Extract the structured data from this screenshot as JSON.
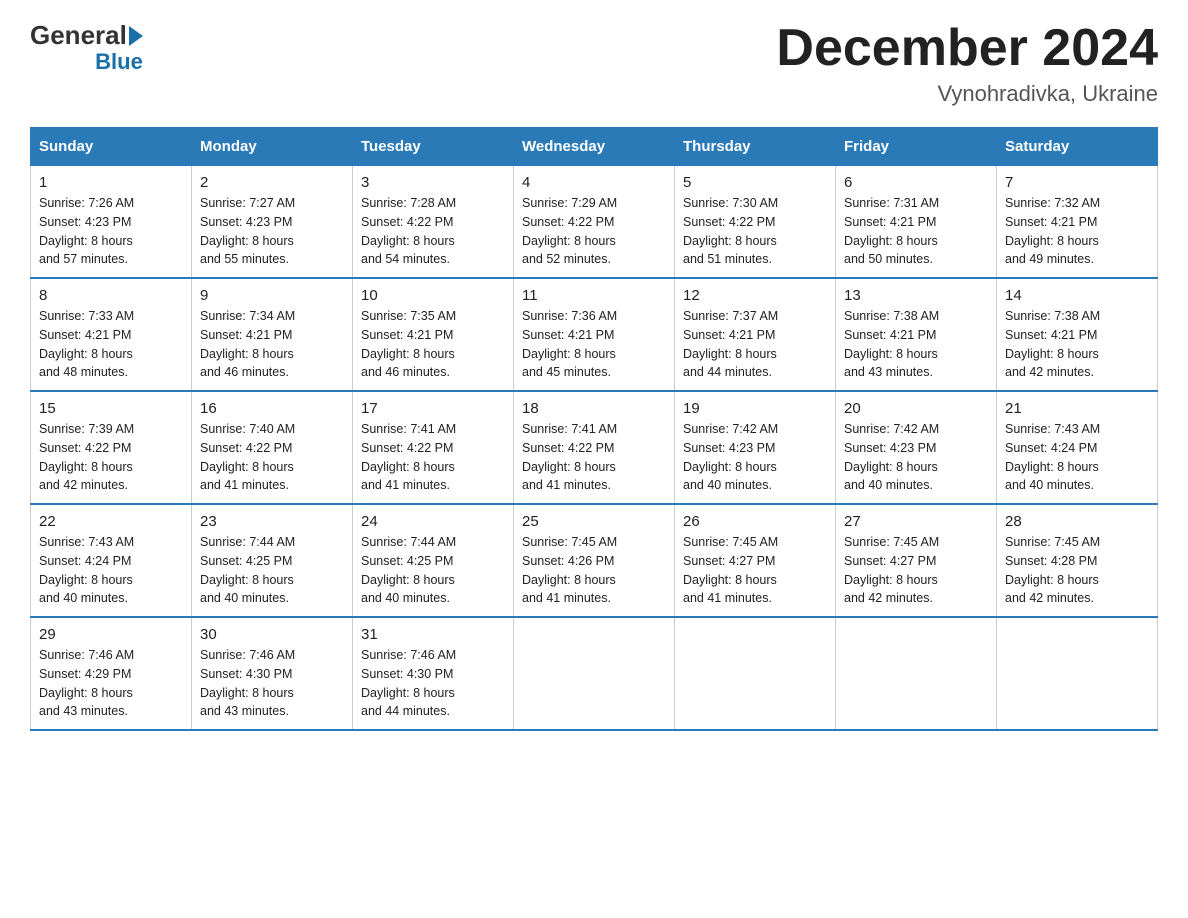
{
  "header": {
    "logo_general": "General",
    "logo_blue": "Blue",
    "month_title": "December 2024",
    "location": "Vynohradivka, Ukraine"
  },
  "days_of_week": [
    "Sunday",
    "Monday",
    "Tuesday",
    "Wednesday",
    "Thursday",
    "Friday",
    "Saturday"
  ],
  "weeks": [
    [
      {
        "day": "1",
        "sunrise": "7:26 AM",
        "sunset": "4:23 PM",
        "daylight": "8 hours and 57 minutes."
      },
      {
        "day": "2",
        "sunrise": "7:27 AM",
        "sunset": "4:23 PM",
        "daylight": "8 hours and 55 minutes."
      },
      {
        "day": "3",
        "sunrise": "7:28 AM",
        "sunset": "4:22 PM",
        "daylight": "8 hours and 54 minutes."
      },
      {
        "day": "4",
        "sunrise": "7:29 AM",
        "sunset": "4:22 PM",
        "daylight": "8 hours and 52 minutes."
      },
      {
        "day": "5",
        "sunrise": "7:30 AM",
        "sunset": "4:22 PM",
        "daylight": "8 hours and 51 minutes."
      },
      {
        "day": "6",
        "sunrise": "7:31 AM",
        "sunset": "4:21 PM",
        "daylight": "8 hours and 50 minutes."
      },
      {
        "day": "7",
        "sunrise": "7:32 AM",
        "sunset": "4:21 PM",
        "daylight": "8 hours and 49 minutes."
      }
    ],
    [
      {
        "day": "8",
        "sunrise": "7:33 AM",
        "sunset": "4:21 PM",
        "daylight": "8 hours and 48 minutes."
      },
      {
        "day": "9",
        "sunrise": "7:34 AM",
        "sunset": "4:21 PM",
        "daylight": "8 hours and 46 minutes."
      },
      {
        "day": "10",
        "sunrise": "7:35 AM",
        "sunset": "4:21 PM",
        "daylight": "8 hours and 46 minutes."
      },
      {
        "day": "11",
        "sunrise": "7:36 AM",
        "sunset": "4:21 PM",
        "daylight": "8 hours and 45 minutes."
      },
      {
        "day": "12",
        "sunrise": "7:37 AM",
        "sunset": "4:21 PM",
        "daylight": "8 hours and 44 minutes."
      },
      {
        "day": "13",
        "sunrise": "7:38 AM",
        "sunset": "4:21 PM",
        "daylight": "8 hours and 43 minutes."
      },
      {
        "day": "14",
        "sunrise": "7:38 AM",
        "sunset": "4:21 PM",
        "daylight": "8 hours and 42 minutes."
      }
    ],
    [
      {
        "day": "15",
        "sunrise": "7:39 AM",
        "sunset": "4:22 PM",
        "daylight": "8 hours and 42 minutes."
      },
      {
        "day": "16",
        "sunrise": "7:40 AM",
        "sunset": "4:22 PM",
        "daylight": "8 hours and 41 minutes."
      },
      {
        "day": "17",
        "sunrise": "7:41 AM",
        "sunset": "4:22 PM",
        "daylight": "8 hours and 41 minutes."
      },
      {
        "day": "18",
        "sunrise": "7:41 AM",
        "sunset": "4:22 PM",
        "daylight": "8 hours and 41 minutes."
      },
      {
        "day": "19",
        "sunrise": "7:42 AM",
        "sunset": "4:23 PM",
        "daylight": "8 hours and 40 minutes."
      },
      {
        "day": "20",
        "sunrise": "7:42 AM",
        "sunset": "4:23 PM",
        "daylight": "8 hours and 40 minutes."
      },
      {
        "day": "21",
        "sunrise": "7:43 AM",
        "sunset": "4:24 PM",
        "daylight": "8 hours and 40 minutes."
      }
    ],
    [
      {
        "day": "22",
        "sunrise": "7:43 AM",
        "sunset": "4:24 PM",
        "daylight": "8 hours and 40 minutes."
      },
      {
        "day": "23",
        "sunrise": "7:44 AM",
        "sunset": "4:25 PM",
        "daylight": "8 hours and 40 minutes."
      },
      {
        "day": "24",
        "sunrise": "7:44 AM",
        "sunset": "4:25 PM",
        "daylight": "8 hours and 40 minutes."
      },
      {
        "day": "25",
        "sunrise": "7:45 AM",
        "sunset": "4:26 PM",
        "daylight": "8 hours and 41 minutes."
      },
      {
        "day": "26",
        "sunrise": "7:45 AM",
        "sunset": "4:27 PM",
        "daylight": "8 hours and 41 minutes."
      },
      {
        "day": "27",
        "sunrise": "7:45 AM",
        "sunset": "4:27 PM",
        "daylight": "8 hours and 42 minutes."
      },
      {
        "day": "28",
        "sunrise": "7:45 AM",
        "sunset": "4:28 PM",
        "daylight": "8 hours and 42 minutes."
      }
    ],
    [
      {
        "day": "29",
        "sunrise": "7:46 AM",
        "sunset": "4:29 PM",
        "daylight": "8 hours and 43 minutes."
      },
      {
        "day": "30",
        "sunrise": "7:46 AM",
        "sunset": "4:30 PM",
        "daylight": "8 hours and 43 minutes."
      },
      {
        "day": "31",
        "sunrise": "7:46 AM",
        "sunset": "4:30 PM",
        "daylight": "8 hours and 44 minutes."
      },
      null,
      null,
      null,
      null
    ]
  ],
  "labels": {
    "sunrise": "Sunrise:",
    "sunset": "Sunset:",
    "daylight": "Daylight:"
  }
}
